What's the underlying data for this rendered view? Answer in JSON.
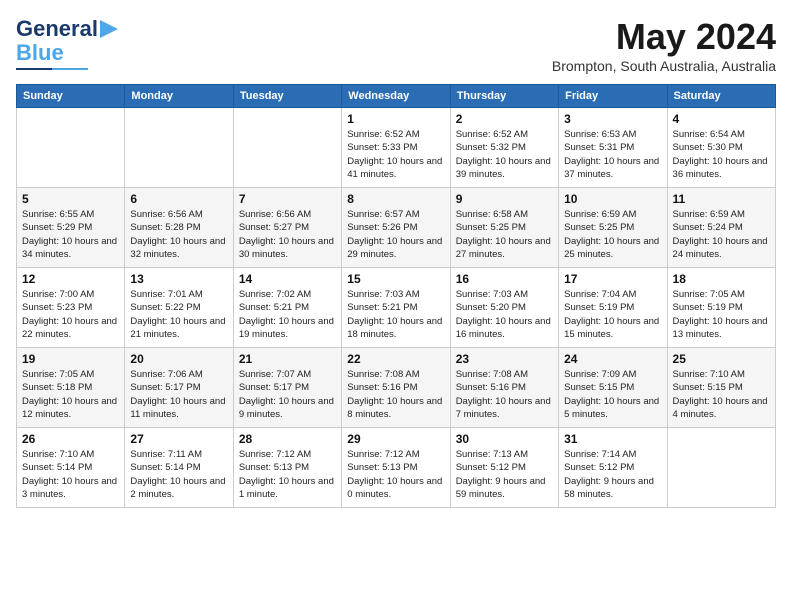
{
  "logo": {
    "line1": "General",
    "line2": "Blue"
  },
  "title": {
    "month": "May 2024",
    "location": "Brompton, South Australia, Australia"
  },
  "headers": [
    "Sunday",
    "Monday",
    "Tuesday",
    "Wednesday",
    "Thursday",
    "Friday",
    "Saturday"
  ],
  "weeks": [
    [
      {
        "day": "",
        "sunrise": "",
        "sunset": "",
        "daylight": ""
      },
      {
        "day": "",
        "sunrise": "",
        "sunset": "",
        "daylight": ""
      },
      {
        "day": "",
        "sunrise": "",
        "sunset": "",
        "daylight": ""
      },
      {
        "day": "1",
        "sunrise": "Sunrise: 6:52 AM",
        "sunset": "Sunset: 5:33 PM",
        "daylight": "Daylight: 10 hours and 41 minutes."
      },
      {
        "day": "2",
        "sunrise": "Sunrise: 6:52 AM",
        "sunset": "Sunset: 5:32 PM",
        "daylight": "Daylight: 10 hours and 39 minutes."
      },
      {
        "day": "3",
        "sunrise": "Sunrise: 6:53 AM",
        "sunset": "Sunset: 5:31 PM",
        "daylight": "Daylight: 10 hours and 37 minutes."
      },
      {
        "day": "4",
        "sunrise": "Sunrise: 6:54 AM",
        "sunset": "Sunset: 5:30 PM",
        "daylight": "Daylight: 10 hours and 36 minutes."
      }
    ],
    [
      {
        "day": "5",
        "sunrise": "Sunrise: 6:55 AM",
        "sunset": "Sunset: 5:29 PM",
        "daylight": "Daylight: 10 hours and 34 minutes."
      },
      {
        "day": "6",
        "sunrise": "Sunrise: 6:56 AM",
        "sunset": "Sunset: 5:28 PM",
        "daylight": "Daylight: 10 hours and 32 minutes."
      },
      {
        "day": "7",
        "sunrise": "Sunrise: 6:56 AM",
        "sunset": "Sunset: 5:27 PM",
        "daylight": "Daylight: 10 hours and 30 minutes."
      },
      {
        "day": "8",
        "sunrise": "Sunrise: 6:57 AM",
        "sunset": "Sunset: 5:26 PM",
        "daylight": "Daylight: 10 hours and 29 minutes."
      },
      {
        "day": "9",
        "sunrise": "Sunrise: 6:58 AM",
        "sunset": "Sunset: 5:25 PM",
        "daylight": "Daylight: 10 hours and 27 minutes."
      },
      {
        "day": "10",
        "sunrise": "Sunrise: 6:59 AM",
        "sunset": "Sunset: 5:25 PM",
        "daylight": "Daylight: 10 hours and 25 minutes."
      },
      {
        "day": "11",
        "sunrise": "Sunrise: 6:59 AM",
        "sunset": "Sunset: 5:24 PM",
        "daylight": "Daylight: 10 hours and 24 minutes."
      }
    ],
    [
      {
        "day": "12",
        "sunrise": "Sunrise: 7:00 AM",
        "sunset": "Sunset: 5:23 PM",
        "daylight": "Daylight: 10 hours and 22 minutes."
      },
      {
        "day": "13",
        "sunrise": "Sunrise: 7:01 AM",
        "sunset": "Sunset: 5:22 PM",
        "daylight": "Daylight: 10 hours and 21 minutes."
      },
      {
        "day": "14",
        "sunrise": "Sunrise: 7:02 AM",
        "sunset": "Sunset: 5:21 PM",
        "daylight": "Daylight: 10 hours and 19 minutes."
      },
      {
        "day": "15",
        "sunrise": "Sunrise: 7:03 AM",
        "sunset": "Sunset: 5:21 PM",
        "daylight": "Daylight: 10 hours and 18 minutes."
      },
      {
        "day": "16",
        "sunrise": "Sunrise: 7:03 AM",
        "sunset": "Sunset: 5:20 PM",
        "daylight": "Daylight: 10 hours and 16 minutes."
      },
      {
        "day": "17",
        "sunrise": "Sunrise: 7:04 AM",
        "sunset": "Sunset: 5:19 PM",
        "daylight": "Daylight: 10 hours and 15 minutes."
      },
      {
        "day": "18",
        "sunrise": "Sunrise: 7:05 AM",
        "sunset": "Sunset: 5:19 PM",
        "daylight": "Daylight: 10 hours and 13 minutes."
      }
    ],
    [
      {
        "day": "19",
        "sunrise": "Sunrise: 7:05 AM",
        "sunset": "Sunset: 5:18 PM",
        "daylight": "Daylight: 10 hours and 12 minutes."
      },
      {
        "day": "20",
        "sunrise": "Sunrise: 7:06 AM",
        "sunset": "Sunset: 5:17 PM",
        "daylight": "Daylight: 10 hours and 11 minutes."
      },
      {
        "day": "21",
        "sunrise": "Sunrise: 7:07 AM",
        "sunset": "Sunset: 5:17 PM",
        "daylight": "Daylight: 10 hours and 9 minutes."
      },
      {
        "day": "22",
        "sunrise": "Sunrise: 7:08 AM",
        "sunset": "Sunset: 5:16 PM",
        "daylight": "Daylight: 10 hours and 8 minutes."
      },
      {
        "day": "23",
        "sunrise": "Sunrise: 7:08 AM",
        "sunset": "Sunset: 5:16 PM",
        "daylight": "Daylight: 10 hours and 7 minutes."
      },
      {
        "day": "24",
        "sunrise": "Sunrise: 7:09 AM",
        "sunset": "Sunset: 5:15 PM",
        "daylight": "Daylight: 10 hours and 5 minutes."
      },
      {
        "day": "25",
        "sunrise": "Sunrise: 7:10 AM",
        "sunset": "Sunset: 5:15 PM",
        "daylight": "Daylight: 10 hours and 4 minutes."
      }
    ],
    [
      {
        "day": "26",
        "sunrise": "Sunrise: 7:10 AM",
        "sunset": "Sunset: 5:14 PM",
        "daylight": "Daylight: 10 hours and 3 minutes."
      },
      {
        "day": "27",
        "sunrise": "Sunrise: 7:11 AM",
        "sunset": "Sunset: 5:14 PM",
        "daylight": "Daylight: 10 hours and 2 minutes."
      },
      {
        "day": "28",
        "sunrise": "Sunrise: 7:12 AM",
        "sunset": "Sunset: 5:13 PM",
        "daylight": "Daylight: 10 hours and 1 minute."
      },
      {
        "day": "29",
        "sunrise": "Sunrise: 7:12 AM",
        "sunset": "Sunset: 5:13 PM",
        "daylight": "Daylight: 10 hours and 0 minutes."
      },
      {
        "day": "30",
        "sunrise": "Sunrise: 7:13 AM",
        "sunset": "Sunset: 5:12 PM",
        "daylight": "Daylight: 9 hours and 59 minutes."
      },
      {
        "day": "31",
        "sunrise": "Sunrise: 7:14 AM",
        "sunset": "Sunset: 5:12 PM",
        "daylight": "Daylight: 9 hours and 58 minutes."
      },
      {
        "day": "",
        "sunrise": "",
        "sunset": "",
        "daylight": ""
      }
    ]
  ]
}
